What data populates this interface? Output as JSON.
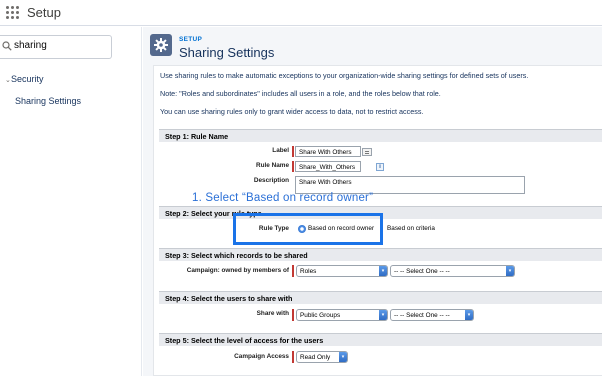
{
  "app": {
    "title": "Setup"
  },
  "sidebar": {
    "search_value": "sharing",
    "tree": {
      "parent": "Security",
      "child": "Sharing Settings"
    }
  },
  "header": {
    "eyebrow": "SETUP",
    "title": "Sharing Settings"
  },
  "intro": [
    "Use sharing rules to make automatic exceptions to your organization-wide sharing settings for defined sets of users.",
    "Note: \"Roles and subordinates\" includes all users in a role, and the roles below that role.",
    "You can use sharing rules only to grant wider access to data, not to restrict access."
  ],
  "step1": {
    "title": "Step 1: Rule Name",
    "label_caption": "Label",
    "label_value": "Share With Others",
    "rule_name_caption": "Rule Name",
    "rule_name_value": "Share_With_Others",
    "info_glyph": "i",
    "description_caption": "Description",
    "description_value": "Share With Others"
  },
  "step2": {
    "title": "Step 2: Select your rule type",
    "rule_type_caption": "Rule Type",
    "option_owner": "Based on record owner",
    "option_criteria": "Based on criteria",
    "selected": "owner"
  },
  "step3": {
    "title": "Step 3: Select which records to be shared",
    "caption": "Campaign: owned by members of",
    "select1": "Roles",
    "select2": "-- -- Select One -- --"
  },
  "step4": {
    "title": "Step 4: Select the users to share with",
    "caption": "Share with",
    "select1": "Public Groups",
    "select2": "-- -- Select One -- --"
  },
  "step5": {
    "title": "Step 5: Select the level of access for the users",
    "caption": "Campaign Access",
    "select1": "Read Only"
  },
  "annotation": {
    "text": "1. Select “Based on record owner”"
  },
  "colors": {
    "accent": "#1a73e8",
    "required": "#c23934",
    "brand_blue": "#0070d2"
  },
  "icons": [
    "app-launcher-icon",
    "search-icon",
    "chevron-down-icon",
    "gear-icon",
    "info-icon",
    "lookup-book-icon",
    "select-arrow-icon"
  ]
}
